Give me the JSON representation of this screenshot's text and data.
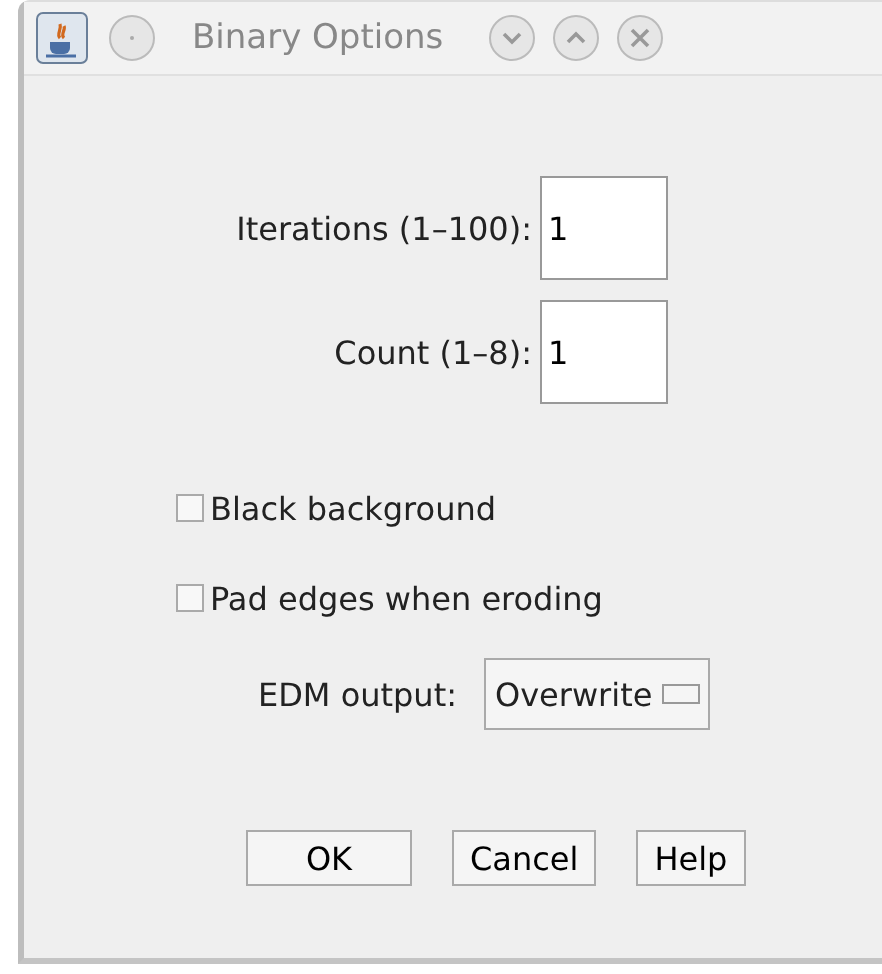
{
  "window": {
    "title": "Binary Options"
  },
  "fields": [
    {
      "label": "Iterations (1–100):",
      "value": "1"
    },
    {
      "label": "Count (1–8):",
      "value": "1"
    }
  ],
  "checkboxes": [
    {
      "label": "Black background",
      "checked": false
    },
    {
      "label": "Pad edges when eroding",
      "checked": false
    }
  ],
  "dropdown": {
    "label": "EDM output:",
    "value": "Overwrite"
  },
  "buttons": [
    "OK",
    "Cancel",
    "Help"
  ]
}
